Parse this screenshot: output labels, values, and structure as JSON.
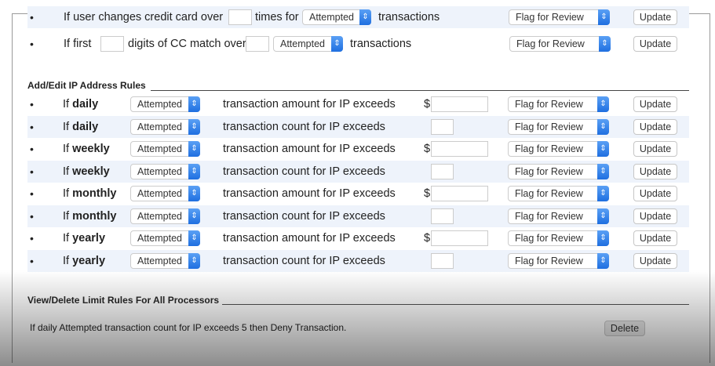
{
  "card_rules": [
    {
      "parts": [
        "If user changes credit card over",
        "times for",
        "transactions"
      ],
      "status": "Attempted",
      "action": "Flag for Review",
      "button": "Update"
    },
    {
      "parts": [
        "If first",
        "digits of CC match over",
        "transactions"
      ],
      "status": "Attempted",
      "action": "Flag for Review",
      "button": "Update"
    }
  ],
  "ip_section": {
    "title": "Add/Edit IP Address Rules",
    "rules": [
      {
        "if": "If",
        "period": "daily",
        "status": "Attempted",
        "desc": "transaction amount for IP exceeds",
        "currency": "$",
        "action": "Flag for Review",
        "button": "Update"
      },
      {
        "if": "If",
        "period": "daily",
        "status": "Attempted",
        "desc": "transaction count for IP exceeds",
        "action": "Flag for Review",
        "button": "Update"
      },
      {
        "if": "If",
        "period": "weekly",
        "status": "Attempted",
        "desc": "transaction amount for IP exceeds",
        "currency": "$",
        "action": "Flag for Review",
        "button": "Update"
      },
      {
        "if": "If",
        "period": "weekly",
        "status": "Attempted",
        "desc": "transaction count for IP exceeds",
        "action": "Flag for Review",
        "button": "Update"
      },
      {
        "if": "If",
        "period": "monthly",
        "status": "Attempted",
        "desc": "transaction amount for IP exceeds",
        "currency": "$",
        "action": "Flag for Review",
        "button": "Update"
      },
      {
        "if": "If",
        "period": "monthly",
        "status": "Attempted",
        "desc": "transaction count for IP exceeds",
        "action": "Flag for Review",
        "button": "Update"
      },
      {
        "if": "If",
        "period": "yearly",
        "status": "Attempted",
        "desc": "transaction amount for IP exceeds",
        "currency": "$",
        "action": "Flag for Review",
        "button": "Update"
      },
      {
        "if": "If",
        "period": "yearly",
        "status": "Attempted",
        "desc": "transaction count for IP exceeds",
        "action": "Flag for Review",
        "button": "Update"
      }
    ]
  },
  "limit_section": {
    "title": "View/Delete Limit Rules For All Processors",
    "rules": [
      {
        "text": "If daily Attempted transaction count for IP exceeds 5 then Deny Transaction.",
        "button": "Delete"
      }
    ]
  }
}
